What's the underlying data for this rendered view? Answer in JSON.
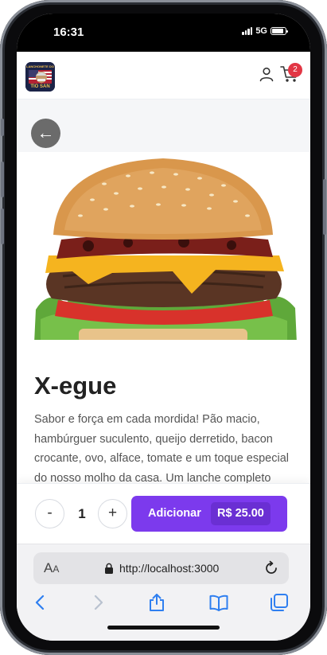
{
  "status_bar": {
    "time": "16:31",
    "network": "5G",
    "battery_level": 0.9
  },
  "app_header": {
    "logo": {
      "text_top": "LANCHONETE DO",
      "text_bottom": "TIO SAN"
    },
    "cart_count": "2"
  },
  "back_button": {
    "label": "←"
  },
  "product": {
    "title": "X-egue",
    "description": "Sabor e força em cada mordida! Pão macio, hambúrguer suculento, queijo derretido, bacon crocante, ovo, alface, tomate e um toque especial do nosso molho da casa. Um lanche completo que levanta qualquer fome!"
  },
  "order": {
    "minus_label": "-",
    "quantity": "1",
    "plus_label": "+",
    "add_label": "Adicionar",
    "price": "R$ 25.00"
  },
  "browser": {
    "aa_label": "AA",
    "url": "http://localhost:3000"
  },
  "colors": {
    "accent": "#7c3aed",
    "badge": "#e23644",
    "ios_blue": "#2f7ff0"
  },
  "icons": [
    "user-icon",
    "cart-icon",
    "lock-icon",
    "reload-icon",
    "back-icon",
    "forward-icon",
    "share-icon",
    "bookmarks-icon",
    "tabs-icon"
  ]
}
